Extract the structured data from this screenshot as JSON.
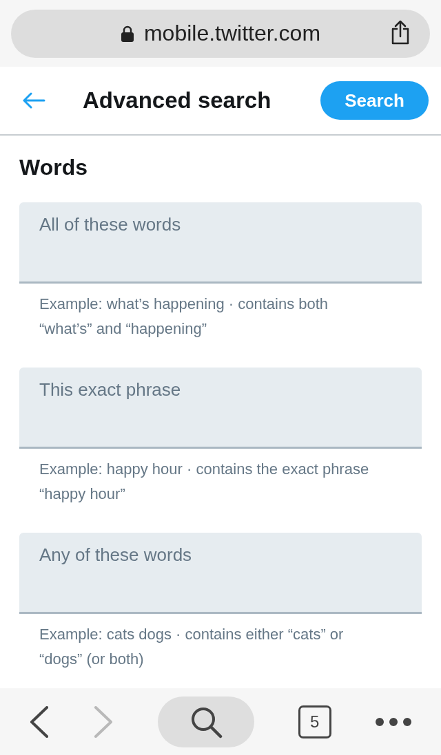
{
  "browser": {
    "address": "mobile.twitter.com"
  },
  "header": {
    "title": "Advanced search",
    "button": "Search"
  },
  "section": {
    "title": "Words"
  },
  "fields": [
    {
      "placeholder": "All of these words",
      "example": "Example: what’s happening · contains both “what’s” and “happening”"
    },
    {
      "placeholder": "This exact phrase",
      "example": "Example: happy hour · contains the exact phrase “happy hour”"
    },
    {
      "placeholder": "Any of these words",
      "example": "Example: cats dogs · contains either “cats” or “dogs” (or both)"
    }
  ],
  "toolbar": {
    "back_disabled": false,
    "forward_disabled": true,
    "tab_count": "5"
  }
}
